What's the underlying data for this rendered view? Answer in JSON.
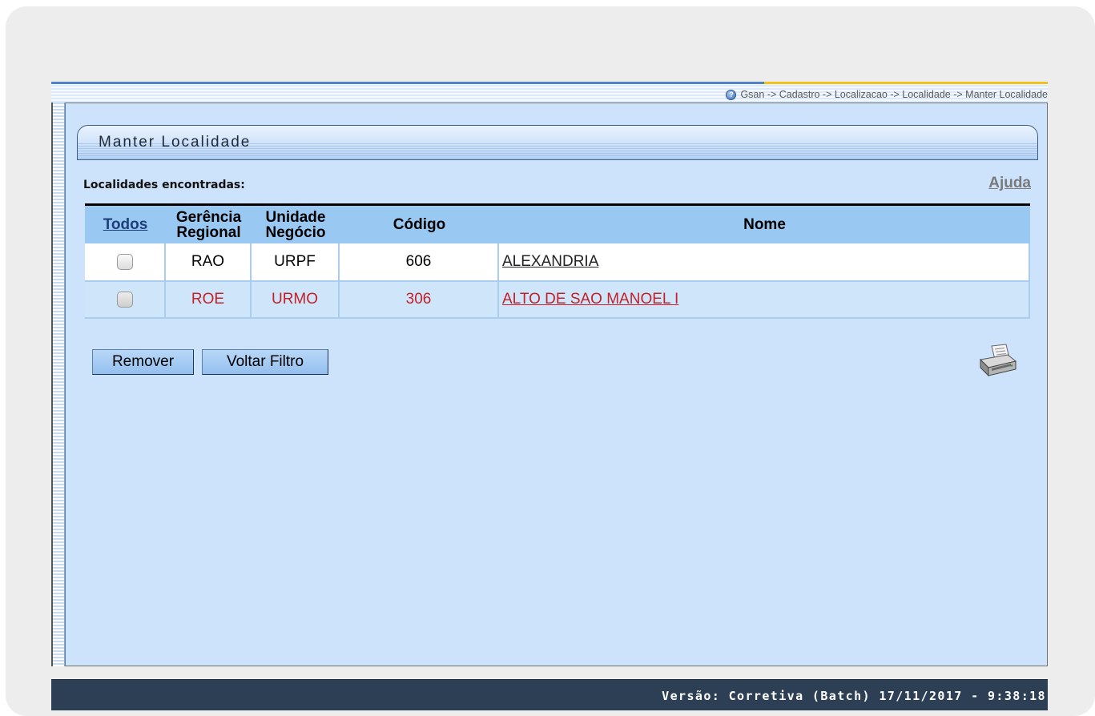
{
  "breadcrumb": "Gsan -> Cadastro -> Localizacao -> Localidade -> Manter Localidade",
  "panel_title": "Manter Localidade",
  "found_label": "Localidades encontradas:",
  "help_link": "Ajuda",
  "table": {
    "headers": {
      "select_all": "Todos",
      "gerencia_line1": "Gerência",
      "gerencia_line2": "Regional",
      "unidade_line1": "Unidade",
      "unidade_line2": "Negócio",
      "codigo": "Código",
      "nome": "Nome"
    },
    "rows": [
      {
        "gerencia": "RAO",
        "unidade": "URPF",
        "codigo": "606",
        "nome": "ALEXANDRIA",
        "checked": false,
        "text_color": "#222222"
      },
      {
        "gerencia": "ROE",
        "unidade": "URMO",
        "codigo": "306",
        "nome": "ALTO DE SAO MANOEL I",
        "checked": false,
        "text_color": "#c42128"
      }
    ]
  },
  "buttons": {
    "remove": "Remover",
    "back_filter": "Voltar Filtro"
  },
  "icons": {
    "help": "help-icon",
    "printer": "printer-icon"
  },
  "footer": {
    "version": "Versão: Corretiva (Batch) 17/11/2017 - 9:38:18"
  },
  "colors": {
    "content_bg": "#cde3fb",
    "header_bg": "#99c8f2",
    "footer_bg": "#2d3f55",
    "error_row_text": "#c42128"
  }
}
